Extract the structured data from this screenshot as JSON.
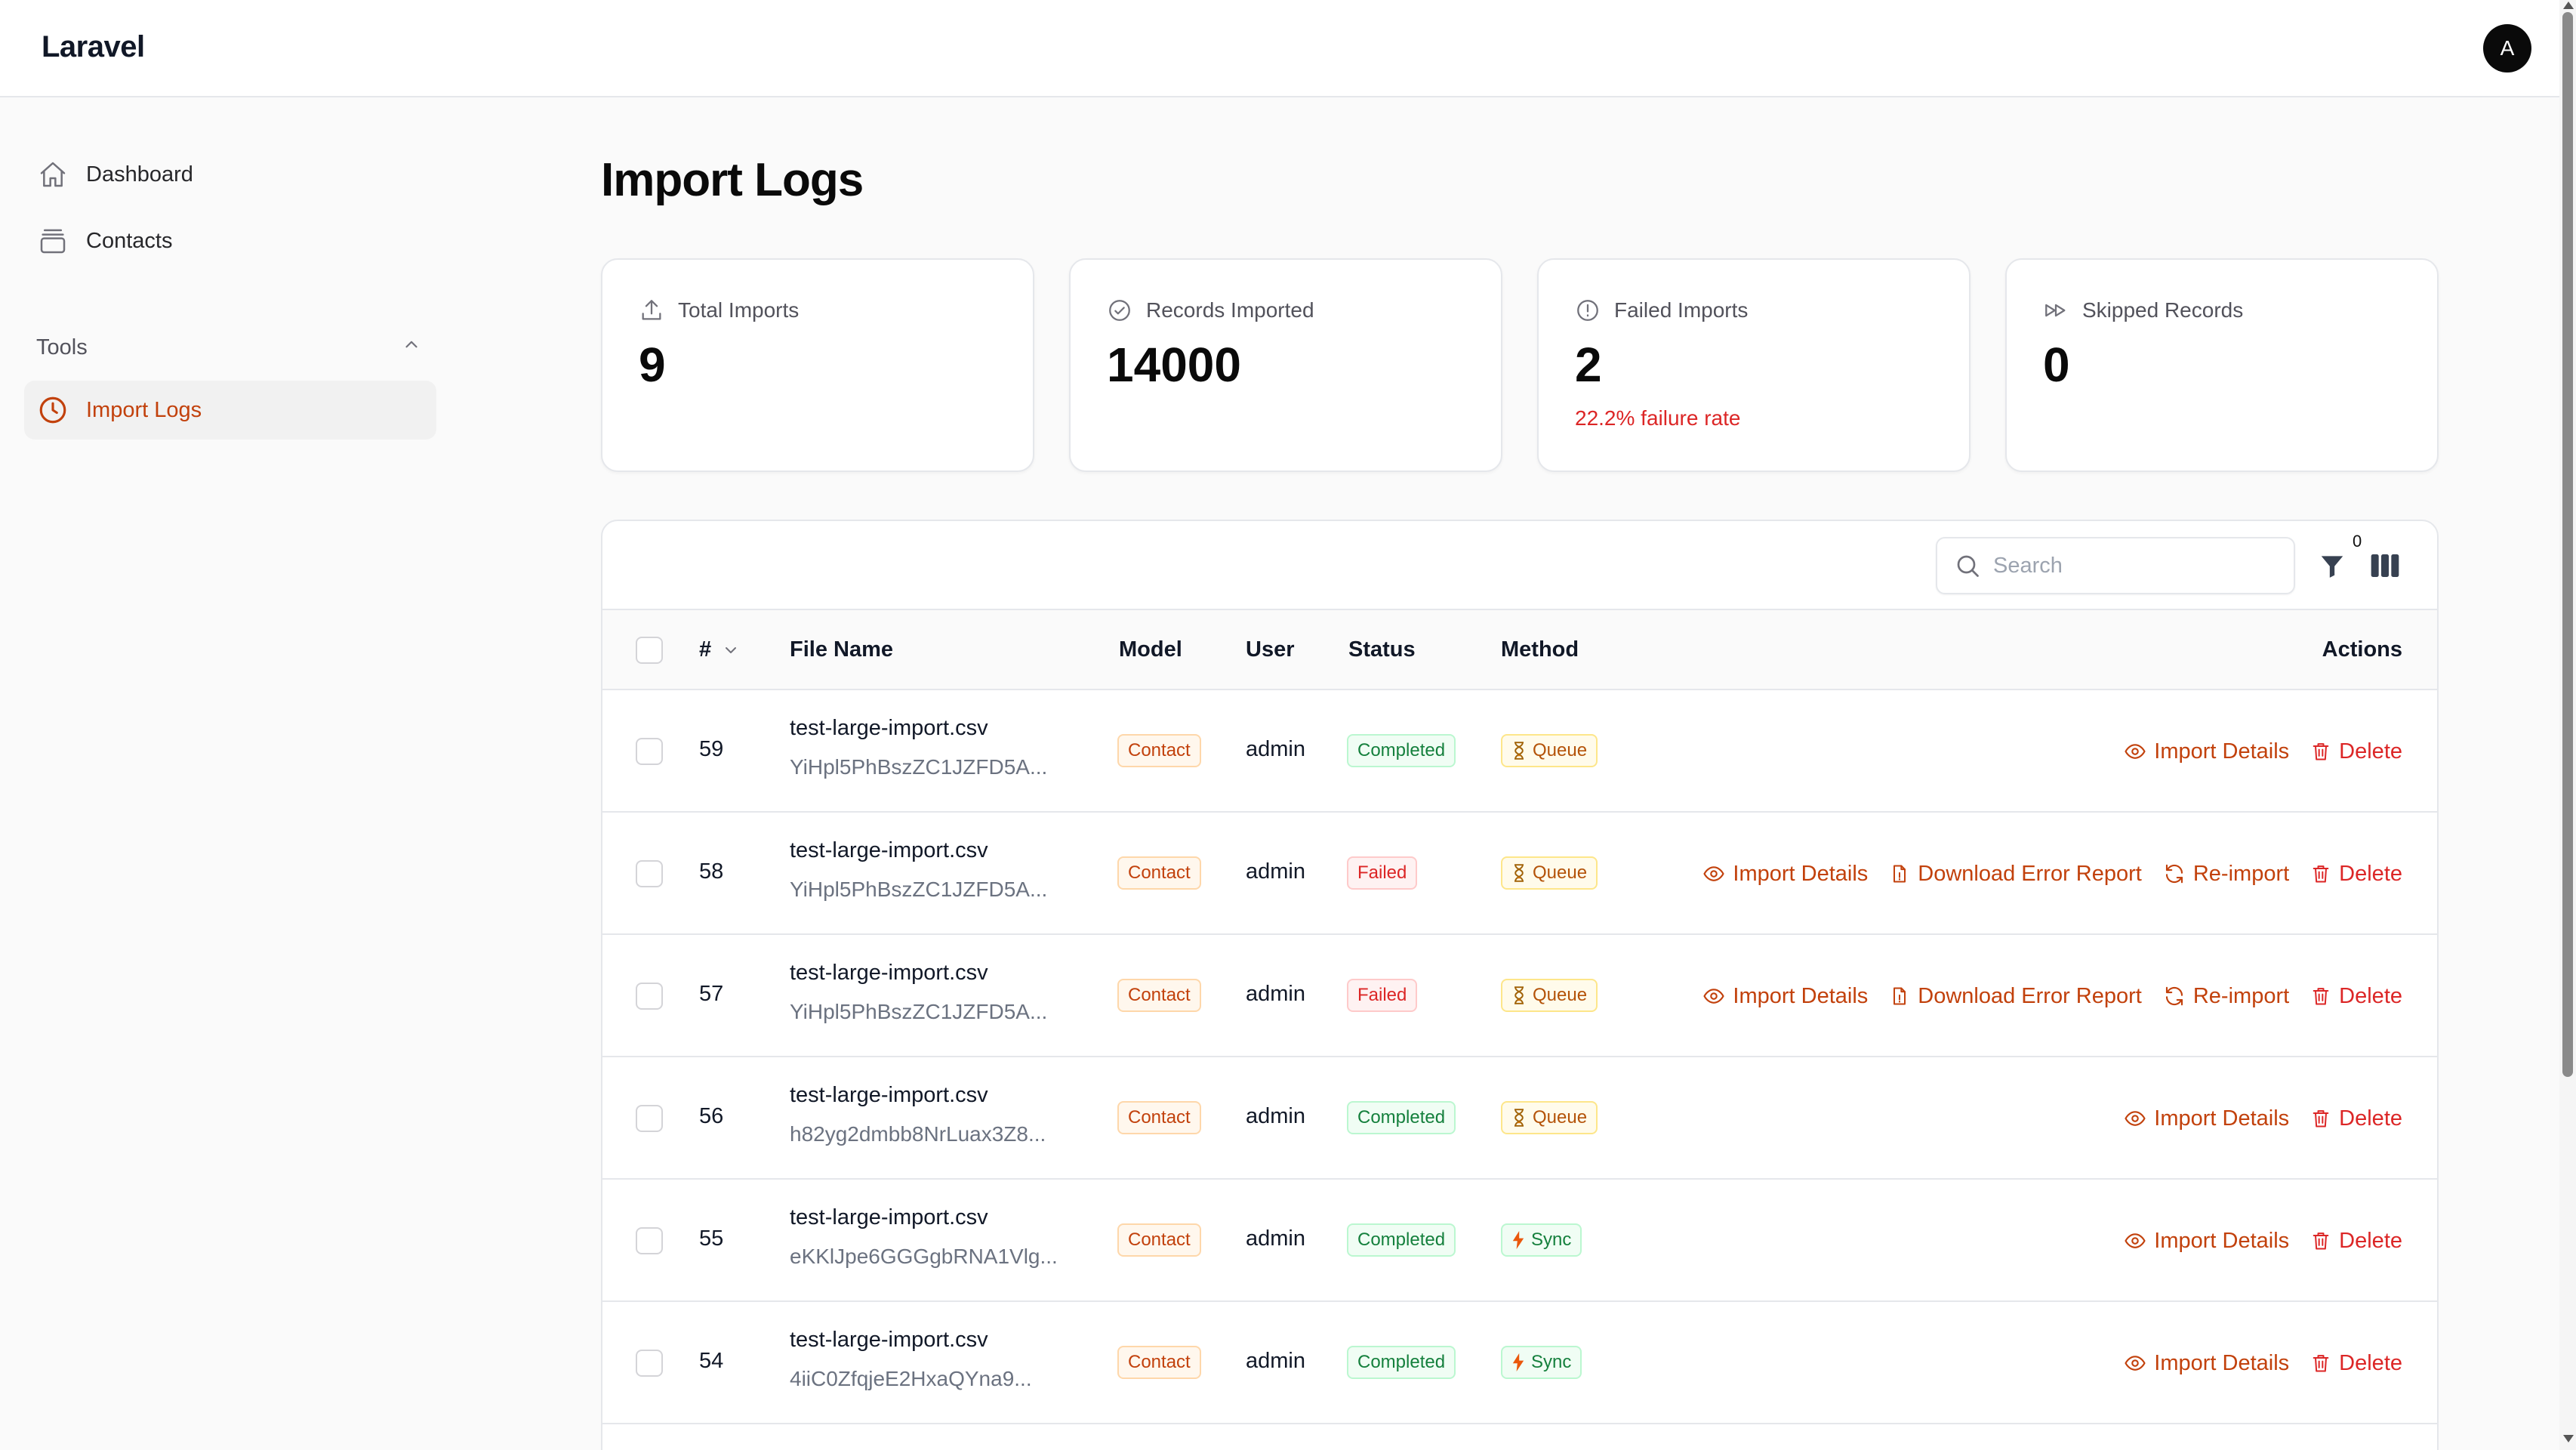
{
  "app": {
    "brand": "Laravel",
    "avatar_initial": "A"
  },
  "sidebar": {
    "items": [
      {
        "label": "Dashboard",
        "icon": "home-icon"
      },
      {
        "label": "Contacts",
        "icon": "inbox-icon"
      }
    ],
    "tools_group": {
      "label": "Tools",
      "icon": "chevron-up-icon"
    },
    "tools_items": [
      {
        "label": "Import Logs",
        "icon": "clock-icon",
        "active": true
      }
    ]
  },
  "page": {
    "title": "Import Logs"
  },
  "stats": [
    {
      "label": "Total Imports",
      "value": "9",
      "sub": "",
      "icon": "upload-icon"
    },
    {
      "label": "Records Imported",
      "value": "14000",
      "sub": "",
      "icon": "check-circle-icon"
    },
    {
      "label": "Failed Imports",
      "value": "2",
      "sub": "22.2% failure rate",
      "icon": "alert-circle-icon"
    },
    {
      "label": "Skipped Records",
      "value": "0",
      "sub": "",
      "icon": "forward-icon"
    }
  ],
  "table": {
    "search_placeholder": "Search",
    "filter_count": "0",
    "columns": {
      "id": "#",
      "file_name": "File Name",
      "model": "Model",
      "user": "User",
      "status": "Status",
      "method": "Method",
      "actions": "Actions"
    },
    "action_labels": {
      "details": "Import Details",
      "error_report": "Download Error Report",
      "reimport": "Re-import",
      "delete": "Delete"
    },
    "rows": [
      {
        "id": "59",
        "file": "test-large-import.csv",
        "hash": "YiHpl5PhBszZC1JZFD5A...",
        "model": "Contact",
        "user": "admin",
        "status": "Completed",
        "method": "Queue"
      },
      {
        "id": "58",
        "file": "test-large-import.csv",
        "hash": "YiHpl5PhBszZC1JZFD5A...",
        "model": "Contact",
        "user": "admin",
        "status": "Failed",
        "method": "Queue"
      },
      {
        "id": "57",
        "file": "test-large-import.csv",
        "hash": "YiHpl5PhBszZC1JZFD5A...",
        "model": "Contact",
        "user": "admin",
        "status": "Failed",
        "method": "Queue"
      },
      {
        "id": "56",
        "file": "test-large-import.csv",
        "hash": "h82yg2dmbb8NrLuax3Z8...",
        "model": "Contact",
        "user": "admin",
        "status": "Completed",
        "method": "Queue"
      },
      {
        "id": "55",
        "file": "test-large-import.csv",
        "hash": "eKKlJpe6GGGgbRNA1Vlg...",
        "model": "Contact",
        "user": "admin",
        "status": "Completed",
        "method": "Sync"
      },
      {
        "id": "54",
        "file": "test-large-import.csv",
        "hash": "4iiC0ZfqjeE2HxaQYna9...",
        "model": "Contact",
        "user": "admin",
        "status": "Completed",
        "method": "Sync"
      }
    ]
  },
  "colors": {
    "accent": "#c2410c",
    "danger": "#dc2626",
    "success": "#15803d",
    "warning": "#b45309"
  }
}
